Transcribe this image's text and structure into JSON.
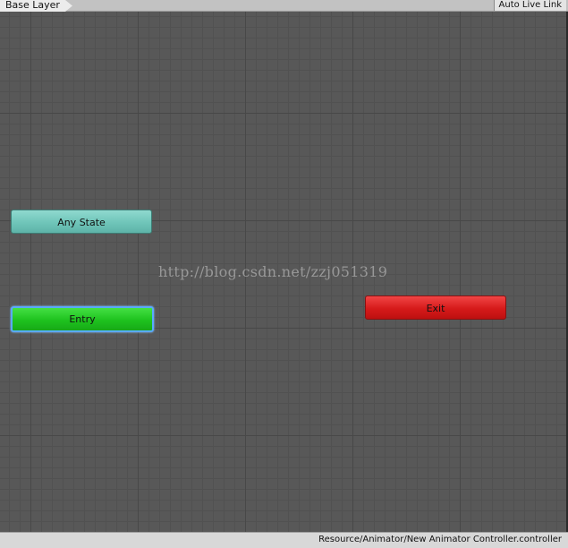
{
  "header": {
    "breadcrumb": "Base Layer",
    "live_link_label": "Auto Live Link"
  },
  "graph": {
    "states": {
      "any_state": {
        "label": "Any State",
        "color": "#6fc5b9"
      },
      "entry": {
        "label": "Entry",
        "color": "#1ec21e"
      },
      "exit": {
        "label": "Exit",
        "color": "#d61a1a"
      }
    },
    "watermark": "http://blog.csdn.net/zzj051319"
  },
  "statusbar": {
    "path": "Resource/Animator/New Animator Controller.controller"
  }
}
